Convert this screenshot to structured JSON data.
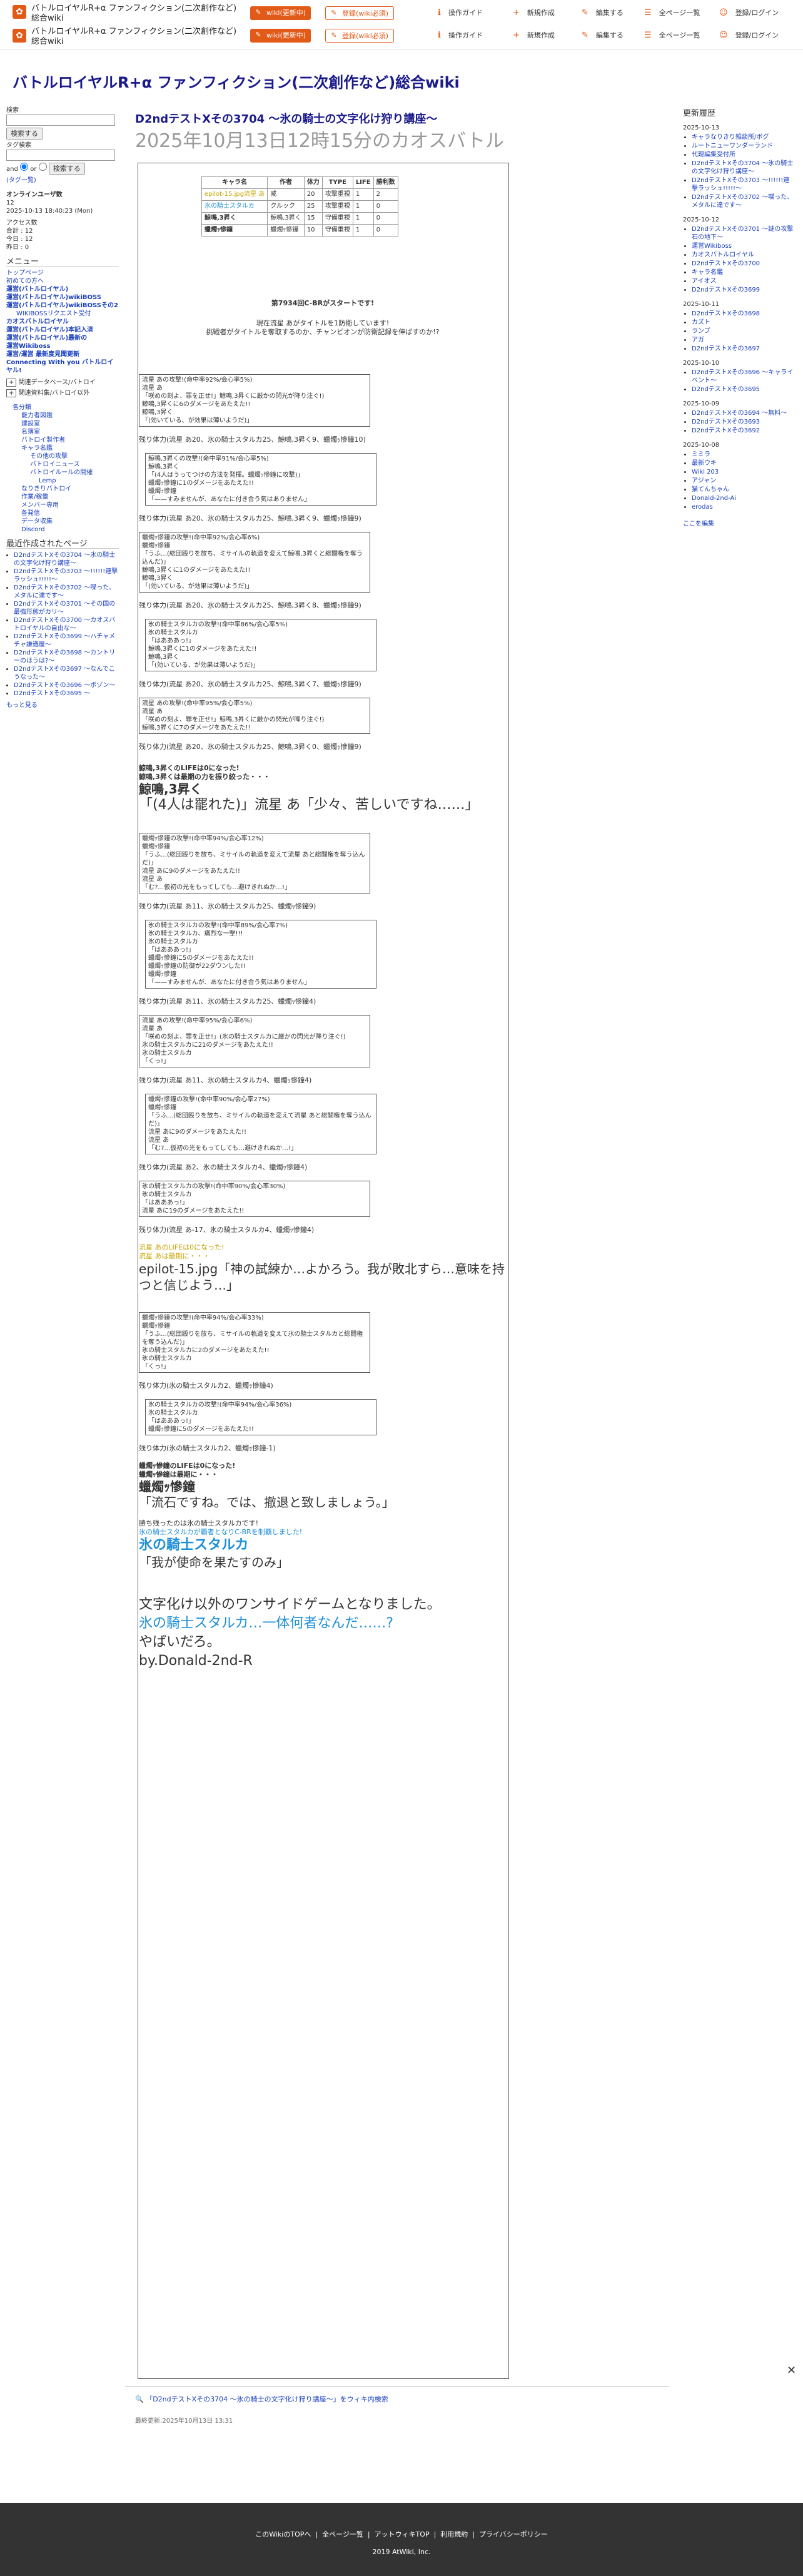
{
  "topbar": {
    "site_name": "バトルロイヤルR+α ファンフィクション(二次創作など)総合wiki",
    "wiki_button": "wiki(更新中)",
    "register_button": "登録(wiki必須)",
    "nav": [
      "操作ガイド",
      "新規作成",
      "編集する",
      "全ページ一覧",
      "登録/ログイン"
    ]
  },
  "site_title": "バトルロイヤルR+α ファンフィクション(二次創作など)総合wiki",
  "left": {
    "search_label": "検索",
    "search_button": "検索する",
    "tag_label": "タグ検索",
    "and_or": [
      "and",
      "or"
    ],
    "tag_search_button": "検索する",
    "tag_list": "(タグ一覧)",
    "online_label": "オンラインユーザ数",
    "online_count": "12",
    "online_time": "2025-10-13 18:40:23 (Mon)",
    "access_label": "アクセス数",
    "access": [
      "合計 : 12",
      "今日 : 12",
      "昨日 : 0"
    ],
    "menu_title": "メニュー",
    "menu": [
      "トップページ",
      "初めての方へ",
      "運営(バトルロイヤル)",
      "運営(バトルロイヤル)wikiBOSS",
      "運営(バトルロイヤル)wikiBOSSその2",
      "WIKIBOSSリクエスト受付",
      "カオスバトルロイヤル",
      "運営(バトルロイヤル)本記入済",
      "運営(バトルロイヤル)最新の",
      "運営Wikiboss",
      "運営/運営 最新度見聞更新",
      "Connecting With you バトルロイヤル!",
      "関連データベース/バトロイ",
      "関連資料集/バトロイ以外"
    ],
    "sub_menu": [
      "各分類",
      "能力者図鑑",
      "建設室",
      "名簿室",
      "バトロイ製作者",
      "キャラ名鑑",
      "その他の攻撃",
      "バトロイニュース",
      "バトロイルールの開催",
      "Lemp",
      "なりきりバトロイ",
      "作業/稼働",
      "メンバー専用",
      "各発信",
      "データ収集",
      "Discord"
    ],
    "recent_title": "最近作成されたページ",
    "recent": [
      "D2ndテストXその3704 〜氷の騎士の文字化け狩り講座〜",
      "D2ndテストXその3703 〜!!!!!!連撃ラッシュ!!!!!〜",
      "D2ndテストXその3702 〜喋った、メタルに達です〜",
      "D2ndテストXその3701 〜その国の最強形態がカリ〜",
      "D2ndテストXその3700 〜カオスバトロイヤルの自由な〜",
      "D2ndテストXその3699 〜ハチャメチャ謙遜屋〜",
      "D2ndテストXその3698 〜カントリーのほうは?〜",
      "D2ndテストXその3697 〜なんでこうなった〜",
      "D2ndテストXその3696 〜ボゾン〜",
      "D2ndテストXその3695 〜"
    ],
    "more": "もっと見る"
  },
  "right": {
    "title": "更新履歴",
    "groups": [
      {
        "date": "2025-10-13",
        "items": [
          "キャラなりきり雑談所/ボグ",
          "ルートニューワンダーランド",
          "代理編集受付所",
          "D2ndテストXその3704 〜氷の騎士の文字化け狩り講座〜",
          "D2ndテストXその3703 〜!!!!!!連撃ラッシュ!!!!!〜",
          "D2ndテストXその3702 〜喋った、メタルに達です〜"
        ]
      },
      {
        "date": "2025-10-12",
        "items": [
          "D2ndテストXその3701 〜謎の攻撃石の地下〜",
          "運営Wikiboss",
          "カオスバトルロイヤル",
          "D2ndテストXその3700",
          "キャラ名鑑",
          "アイオス",
          "D2ndテストXその3699"
        ]
      },
      {
        "date": "2025-10-11",
        "items": [
          "D2ndテストXその3698",
          "カズト",
          "ランプ",
          "アガ",
          "D2ndテストXその3697"
        ]
      },
      {
        "date": "2025-10-10",
        "items": [
          "D2ndテストXその3696 〜キャライベント〜",
          "D2ndテストXその3695"
        ]
      },
      {
        "date": "2025-10-09",
        "items": [
          "D2ndテストXその3694 〜無料〜",
          "D2ndテストXその3693",
          "D2ndテストXその3692"
        ]
      },
      {
        "date": "2025-10-08",
        "items": [
          "ミミラ",
          "最新ウキ",
          "Wiki 203",
          "アジャン",
          "猫てんちゃん",
          "Donald-2nd-Ai",
          "erodas"
        ]
      }
    ],
    "edit_link": "ここを編集"
  },
  "main": {
    "title": "D2ndテストXその3704 〜氷の騎士の文字化け狩り講座〜",
    "subtitle": "2025年10月13日12時15分のカオスバトル",
    "table_headers": [
      "キャラ名",
      "作者",
      "体力",
      "TYPE",
      "LIFE",
      "勝利数"
    ],
    "table_rows": [
      [
        "epilot-15.jpg流星 あ",
        "咸",
        "20",
        "攻撃重視",
        "1",
        "2"
      ],
      [
        "氷の騎士スタルカ",
        "クルック",
        "25",
        "攻撃重視",
        "1",
        "0"
      ],
      [
        "鯨鳴,3昇く",
        "鯨鳴,3昇く",
        "15",
        "守備重視",
        "1",
        "0"
      ],
      [
        "蠟燭ｯ慘鐘",
        "蠟燭ｯ慘鐘",
        "10",
        "守備重視",
        "1",
        "0"
      ]
    ],
    "start_line": "第7934回C-BRがスタートです!",
    "intro1": "現在流星 あがタイトルを1防衛しています!",
    "intro2": "挑戦者がタイトルを奪取するのか、チャンピオンが防衛記録を伸ばすのか!?",
    "turns": [
      {
        "box": [
          "流星 あの攻撃!(命中率92%/会心率5%)",
          "流星 あ",
          "「咲めの刻よ、罪を正せ!」鯨鳴,3昇くに厳かの閃光が降り注ぐ!)",
          "鯨鳴,3昇くに6のダメージをあたえた!!",
          "鯨鳴,3昇く",
          "「(効いている、が効果は薄いようだ)」"
        ],
        "rem": "残り体力(流星 あ20、氷の騎士スタルカ25、鯨鳴,3昇く9、蠟燭ｯ慘鐘10)"
      },
      {
        "box": [
          "鯨鳴,3昇くの攻撃!(命中率91%/会心率5%)",
          "鯨鳴,3昇く",
          "「(4人はうってつけの方法を発揮。蠟燭ｯ慘鐘に攻撃)」",
          "蠟燭ｯ慘鐘に1のダメージをあたえた!!",
          "蠟燭ｯ慘鐘",
          "「——すみませんが、あなたに付き合う気はありません」"
        ],
        "rem": "残り体力(流星 あ20、氷の騎士スタルカ25、鯨鳴,3昇く9、蠟燭ｯ慘鐘9)"
      },
      {
        "box": [
          "蠟燭ｯ慘鐘の攻撃!(命中率92%/会心率6%)",
          "蠟燭ｯ慘鐘",
          "「うふ…(総団殴りを放ち、ミサイルの軌道を変えて鯨鳴,3昇くと総闘権を奪う込んだ)」",
          "鯨鳴,3昇くに1のダメージをあたえた!!",
          "鯨鳴,3昇く",
          "「(効いている、が効果は薄いようだ)」"
        ],
        "rem": "残り体力(流星 あ20、氷の騎士スタルカ25、鯨鳴,3昇く8、蠟燭ｯ慘鐘9)"
      },
      {
        "box": [
          "氷の騎士スタルカの攻撃!(命中率86%/会心率5%)",
          "氷の騎士スタルカ",
          "「はあああっ!」",
          "鯨鳴,3昇くに1のダメージをあたえた!!",
          "鯨鳴,3昇く",
          "「(効いている、が効果は薄いようだ)」"
        ],
        "rem": "残り体力(流星 あ20、氷の騎士スタルカ25、鯨鳴,3昇く7、蠟燭ｯ慘鐘9)"
      },
      {
        "box": [
          "流星 あの攻撃!(命中率95%/会心率5%)",
          "流星 あ",
          "「咲めの刻よ、罪を正せ!」鯨鳴,3昇くに厳かの閃光が降り注ぐ!)",
          "鯨鳴,3昇くに7のダメージをあたえた!!"
        ],
        "rem": "残り体力(流星 あ20、氷の騎士スタルカ25、鯨鳴,3昇く0、蠟燭ｯ慘鐘9)"
      }
    ],
    "death1a": "鯨鳴,3昇くのLIFEは0になった!",
    "death1b": "鯨鳴,3昇くは最期の力を振り絞った・・・",
    "death1_name": "鯨鳴,3昇く",
    "death1_quote": "「(4人は罷れた)」流星 あ「少々、苦しいですね……」",
    "turns2": [
      {
        "box": [
          "蠟燭ｯ慘鐘の攻撃!(命中率94%/会心率12%)",
          "蠟燭ｯ慘鐘",
          "「うふ…(総団殴りを放ち、ミサイルの軌道を変えて流星 あと総闘権を奪う込んだ)」",
          "流星 あに9のダメージをあたえた!!",
          "流星 あ",
          "「む?…仮初の光をもってしても…避けきれぬか…!」"
        ],
        "rem": "残り体力(流星 あ11、氷の騎士スタルカ25、蠟燭ｯ慘鐘9)"
      },
      {
        "box": [
          "氷の騎士スタルカの攻撃!(命中率89%/会心率7%)",
          "氷の騎士スタルカ、痛烈な一撃!!!",
          "氷の騎士スタルカ",
          "「はあああっ!」",
          "蠟燭ｯ慘鐘に5のダメージをあたえた!!",
          "蠟燭ｯ慘鐘の防御が22ダウンした!!",
          "蠟燭ｯ慘鐘",
          "「——すみませんが、あなたに付き合う気はありません」"
        ],
        "rem": "残り体力(流星 あ11、氷の騎士スタルカ25、蠟燭ｯ慘鐘4)"
      },
      {
        "box": [
          "流星 あの攻撃!(命中率95%/会心率6%)",
          "流星 あ",
          "「咲めの刻よ、罪を正せ!」(氷の騎士スタルカに厳かの閃光が降り注ぐ!)",
          "氷の騎士スタルカに21のダメージをあたえた!!",
          "氷の騎士スタルカ",
          "「くっ!」"
        ],
        "rem": "残り体力(流星 あ11、氷の騎士スタルカ4、蠟燭ｯ慘鐘4)"
      },
      {
        "box": [
          "蠟燭ｯ慘鐘の攻撃!(命中率90%/会心率27%)",
          "蠟燭ｯ慘鐘",
          "「うふ…(総団殴りを放ち、ミサイルの軌道を変えて流星 あと総闘権を奪う込んだ)」",
          "流星 あに9のダメージをあたえた!!",
          "流星 あ",
          "「む?…仮初の光をもってしても…避けきれぬか…!」"
        ],
        "rem": "残り体力(流星 あ2、氷の騎士スタルカ4、蠟燭ｯ慘鐘4)"
      },
      {
        "box": [
          "氷の騎士スタルカの攻撃!(命中率90%/会心率30%)",
          "氷の騎士スタルカ",
          "「はあああっ!」",
          "流星 あに19のダメージをあたえた!!"
        ],
        "rem": "残り体力(流星 あ-17、氷の騎士スタルカ4、蠟燭ｯ慘鐘4)"
      }
    ],
    "death2a": "流星 あのLIFEは0になった!",
    "death2b": "流星 あは最期に・・・",
    "death2_quote": "epilot-15.jpg「神の試練か…よかろう。我が敗北すら…意味を持つと信じよう…」",
    "turns3": [
      {
        "box": [
          "蠟燭ｯ慘鐘の攻撃!(命中率94%/会心率33%)",
          "蠟燭ｯ慘鐘",
          "「うふ…(総団殴りを放ち、ミサイルの軌道を変えて氷の騎士スタルカと総闘権を奪う込んだ)」",
          "氷の騎士スタルカに2のダメージをあたえた!!",
          "氷の騎士スタルカ",
          "「くっ!」"
        ],
        "rem": "残り体力(氷の騎士スタルカ2、蠟燭ｯ慘鐘4)"
      },
      {
        "box": [
          "氷の騎士スタルカの攻撃!(命中率94%/会心率36%)",
          "氷の騎士スタルカ",
          "「はあああっ!」",
          "蠟燭ｯ慘鐘に5のダメージをあたえた!!"
        ],
        "rem": "残り体力(氷の騎士スタルカ2、蠟燭ｯ慘鐘-1)"
      }
    ],
    "death3a": "蠟燭ｯ慘鐘のLIFEは0になった!",
    "death3b": "蠟燭ｯ慘鐘は最期に・・・",
    "death3_name": "蠟燭ｯ慘鐘",
    "death3_quote": "「流石ですね。では、撤退と致しましょう。」",
    "winner_line": "勝ち残ったのは氷の騎士スタルカです!",
    "winner_line2": "氷の騎士スタルカが覇者となりC-BRを制覇しました!",
    "winner_name": "氷の騎士スタルカ",
    "winner_quote": "「我が使命を果たすのみ」",
    "ending1": "文字化け以外のワンサイドゲームとなりました。",
    "ending2": "氷の騎士スタルカ…一体何者なんだ……?",
    "ending3": "やばいだろ。",
    "ending4": "by.Donald-2nd-R"
  },
  "wiki_link": "「D2ndテストXその3704 〜氷の騎士の文字化け狩り講座〜」をウィキ内検索",
  "last_update": "最終更新:2025年10月13日 13:31",
  "footer": {
    "links": [
      "このWikiのTOPへ",
      "全ページ一覧",
      "アットウィキTOP",
      "利用規約",
      "プライバシーポリシー"
    ],
    "copyright": "2019 AtWiki, Inc."
  }
}
